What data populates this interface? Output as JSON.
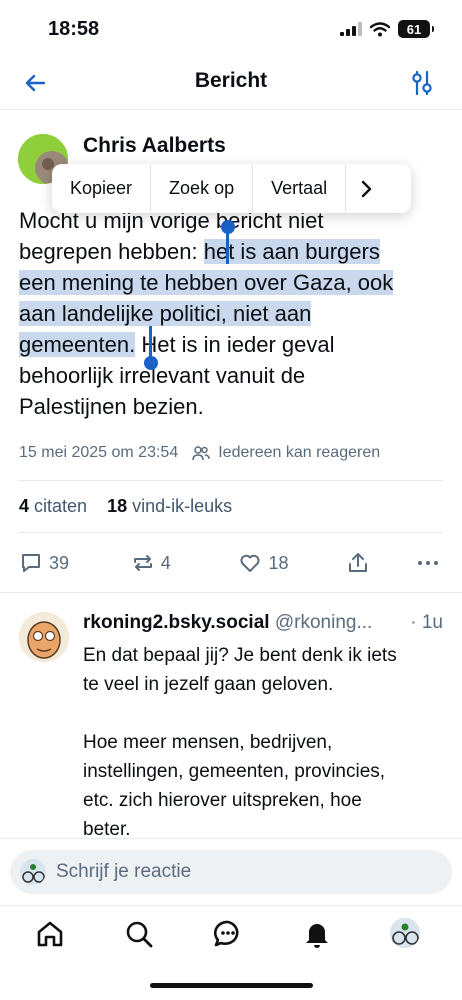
{
  "status_bar": {
    "time": "18:58",
    "battery": "61"
  },
  "header": {
    "title": "Bericht"
  },
  "post": {
    "author": "Chris Aalberts",
    "text_line1": "Mocht u mijn vorige bericht niet",
    "text_plain2": "begrepen hebben: ",
    "text_sel2": "het is aan burgers",
    "text_sel3": "een mening te hebben over Gaza, ook",
    "text_sel4": "aan landelijke politici, niet aan",
    "text_sel5": "gemeenten.",
    "text_plain5": " Het is in ieder geval",
    "text_line6": "behoorlijk irrelevant vanuit de",
    "text_line7": "Palestijnen bezien.",
    "timestamp": "15 mei 2025 om 23:54",
    "reply_setting": "Iedereen kan reageren",
    "quotes_count": "4",
    "quotes_label": "citaten",
    "likes_count": "18",
    "likes_label": "vind-ik-leuks",
    "actions": {
      "replies": "39",
      "reposts": "4",
      "likes": "18"
    }
  },
  "context_menu": {
    "items": [
      "Kopieer",
      "Zoek op",
      "Vertaal"
    ],
    "more": "›"
  },
  "reply": {
    "name": "rkoning2.bsky.social",
    "handle": "@rkoning...",
    "time": "· 1u",
    "text": "En dat bepaal jij? Je bent denk ik iets\nte veel in jezelf gaan geloven.\n\nHoe meer mensen, bedrijven,\ninstellingen, gemeenten, provincies,\netc. zich hierover uitspreken, hoe\nbeter."
  },
  "composer": {
    "placeholder": "Schrijf je reactie"
  },
  "colors": {
    "accent": "#1a62c7",
    "selection": "#c9d8ec",
    "muted": "#5a6b7d"
  },
  "icons": [
    "back-arrow-icon",
    "filter-sliders-icon",
    "reply-icon",
    "repost-icon",
    "heart-icon",
    "share-icon",
    "more-icon",
    "people-icon",
    "home-icon",
    "search-icon",
    "chat-icon",
    "bell-icon"
  ]
}
